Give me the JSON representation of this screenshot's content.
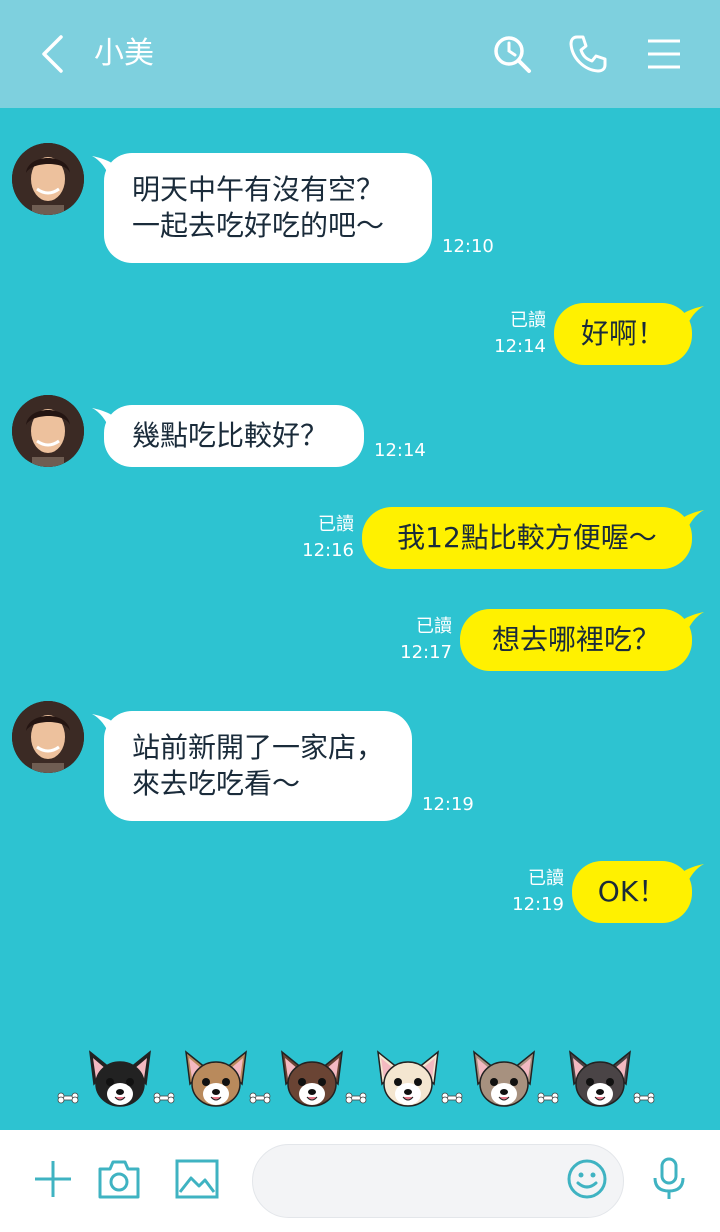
{
  "header": {
    "back_icon": "chevron-left-icon",
    "title": "小美",
    "icons": [
      "search-icon",
      "phone-icon",
      "menu-icon"
    ]
  },
  "messages": [
    {
      "side": "in",
      "lines": [
        "明天中午有沒有空？",
        "一起去吃好吃的吧～"
      ],
      "time": "12:10"
    },
    {
      "side": "out",
      "text": "好啊！",
      "read": "已讀",
      "time": "12:14"
    },
    {
      "side": "in",
      "lines": [
        "幾點吃比較好？"
      ],
      "time": "12:14"
    },
    {
      "side": "out",
      "text": "我12點比較方便喔～",
      "read": "已讀",
      "time": "12:16"
    },
    {
      "side": "out",
      "text": "想去哪裡吃？",
      "read": "已讀",
      "time": "12:17"
    },
    {
      "side": "in",
      "lines": [
        "站前新開了一家店，",
        "來去吃吃看～"
      ],
      "time": "12:19"
    },
    {
      "side": "out",
      "text": "OK！",
      "read": "已讀",
      "time": "12:19"
    }
  ],
  "decoration": {
    "dog_colors": [
      "#222222",
      "#b98a5c",
      "#6a4434",
      "#f4e6d0",
      "#a7917f",
      "#4a4446"
    ]
  },
  "footer": {
    "icons": [
      "plus-icon",
      "camera-icon",
      "image-icon",
      "emoji-icon",
      "microphone-icon"
    ],
    "input_placeholder": "",
    "input_value": ""
  },
  "colors": {
    "background": "#2dc3d1",
    "header": "#7ed0de",
    "outgoing_bubble": "#fff100",
    "incoming_bubble": "#ffffff",
    "icon_accent": "#3fb3c2"
  }
}
